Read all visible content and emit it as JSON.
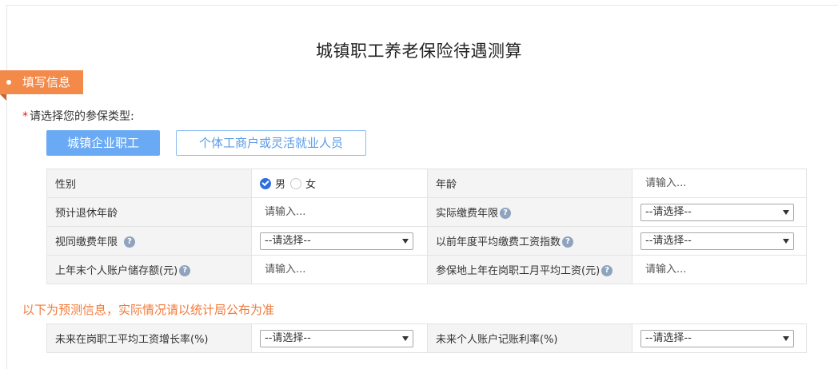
{
  "page_title": "城镇职工养老保险待遇测算",
  "section_tag": "填写信息",
  "insured_type": {
    "required_mark": "*",
    "prompt": "请选择您的参保类型:",
    "options": [
      "城镇企业职工",
      "个体工商户或灵活就业人员"
    ],
    "selected": "城镇企业职工"
  },
  "form": {
    "gender": {
      "label": "性别",
      "options": [
        "男",
        "女"
      ],
      "selected": "男"
    },
    "age": {
      "label": "年龄",
      "placeholder": "请输入..."
    },
    "retire_age": {
      "label": "预计退休年龄",
      "placeholder": "请输入..."
    },
    "actual_years": {
      "label": "实际缴费年限",
      "value": "--请选择--"
    },
    "deemed_years": {
      "label": "视同缴费年限",
      "value": "--请选择--"
    },
    "avg_index": {
      "label": "以前年度平均缴费工资指数",
      "value": "--请选择--"
    },
    "account_balance": {
      "label": "上年末个人账户储存额(元)",
      "placeholder": "请输入..."
    },
    "local_avg_wage": {
      "label": "参保地上年在岗职工月平均工资(元)",
      "placeholder": "请输入..."
    }
  },
  "notice": "以下为预测信息，实际情况请以统计局公布为准",
  "forecast": {
    "wage_growth": {
      "label": "未来在岗职工平均工资增长率(%)",
      "value": "--请选择--"
    },
    "interest_rate": {
      "label": "未来个人账户记账利率(%)",
      "value": "--请选择--"
    }
  },
  "help_glyph": "?"
}
